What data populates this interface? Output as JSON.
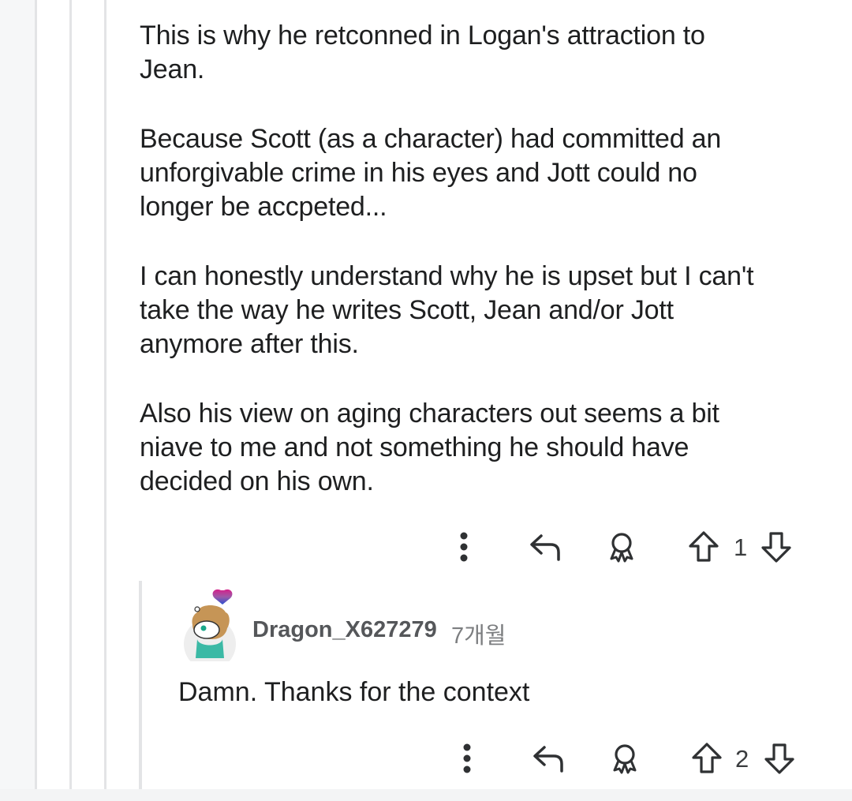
{
  "comment": {
    "paragraphs": [
      "This is why he retconned in Logan's attraction to\nJean.",
      "Because Scott (as a character) had committed an\nunforgivable crime in his eyes and Jott could no\nlonger be accpeted...",
      "I can honestly understand why he is upset but I can't\ntake the way he writes Scott, Jean and/or Jott\nanymore after this.",
      "Also his view on aging characters out seems a bit\nniave to me and not something he should have\ndecided on his own."
    ],
    "vote_count": "1"
  },
  "reply": {
    "username": "Dragon_X627279",
    "timestamp": "7개월",
    "text": "Damn. Thanks for the context",
    "vote_count": "2"
  },
  "icons": {
    "more": "more-vertical-icon",
    "reply": "reply-arrow-icon",
    "award": "award-icon",
    "upvote": "upvote-arrow-icon",
    "downvote": "downvote-arrow-icon"
  },
  "colors": {
    "text": "#1e1f20",
    "muted": "#55575a",
    "thread_line": "#e3e4e6",
    "icon": "#3a3c3e"
  }
}
